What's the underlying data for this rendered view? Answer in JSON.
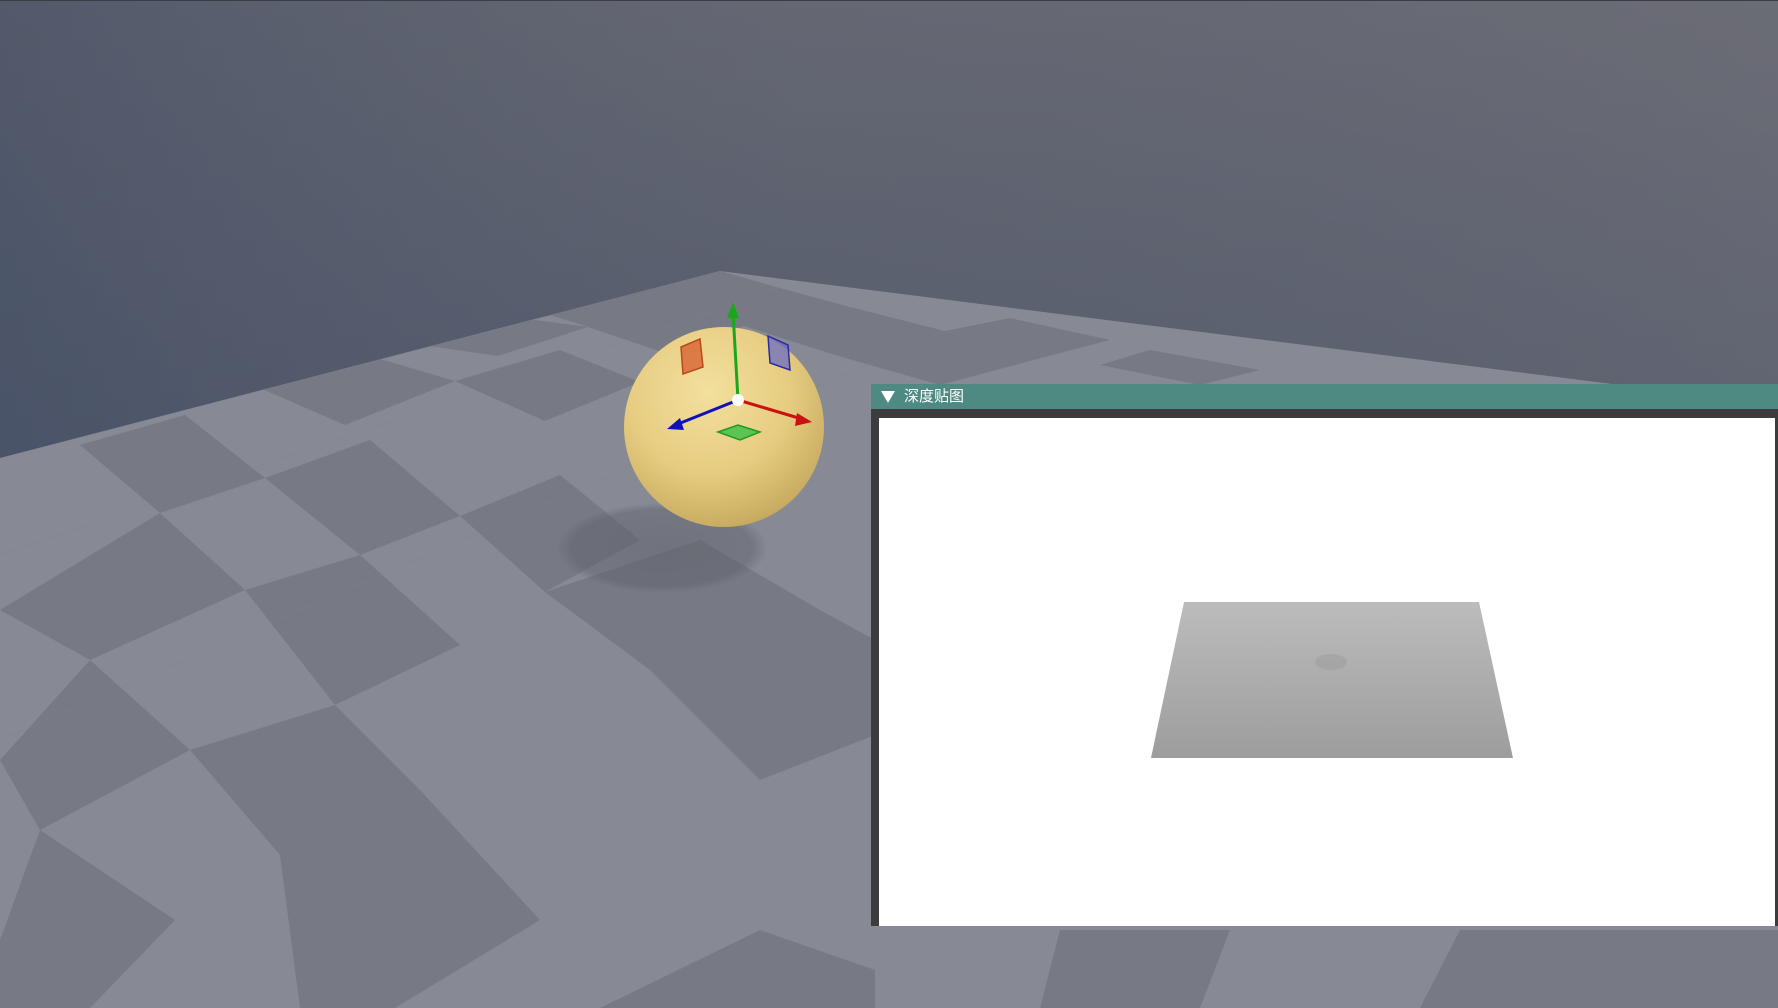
{
  "viewport": {
    "colors": {
      "sky_top": "#676973",
      "sky_bottom": "#485468",
      "floor_light": "#8c8f99",
      "floor_dark": "#7a7d87",
      "sphere": "#e8cf85",
      "axis_x": "#cc1111",
      "axis_y": "#1aa81a",
      "axis_z": "#1111bb"
    },
    "gizmo_icon": "transform-gizmo-icon"
  },
  "debug_window": {
    "title": "深度贴图",
    "collapse_icon": "collapse-triangle-icon",
    "colors": {
      "titlebar": "#4f8a82",
      "content_bg": "#ffffff",
      "depth_near": "#bdbdbd",
      "depth_far": "#9f9f9f"
    }
  }
}
